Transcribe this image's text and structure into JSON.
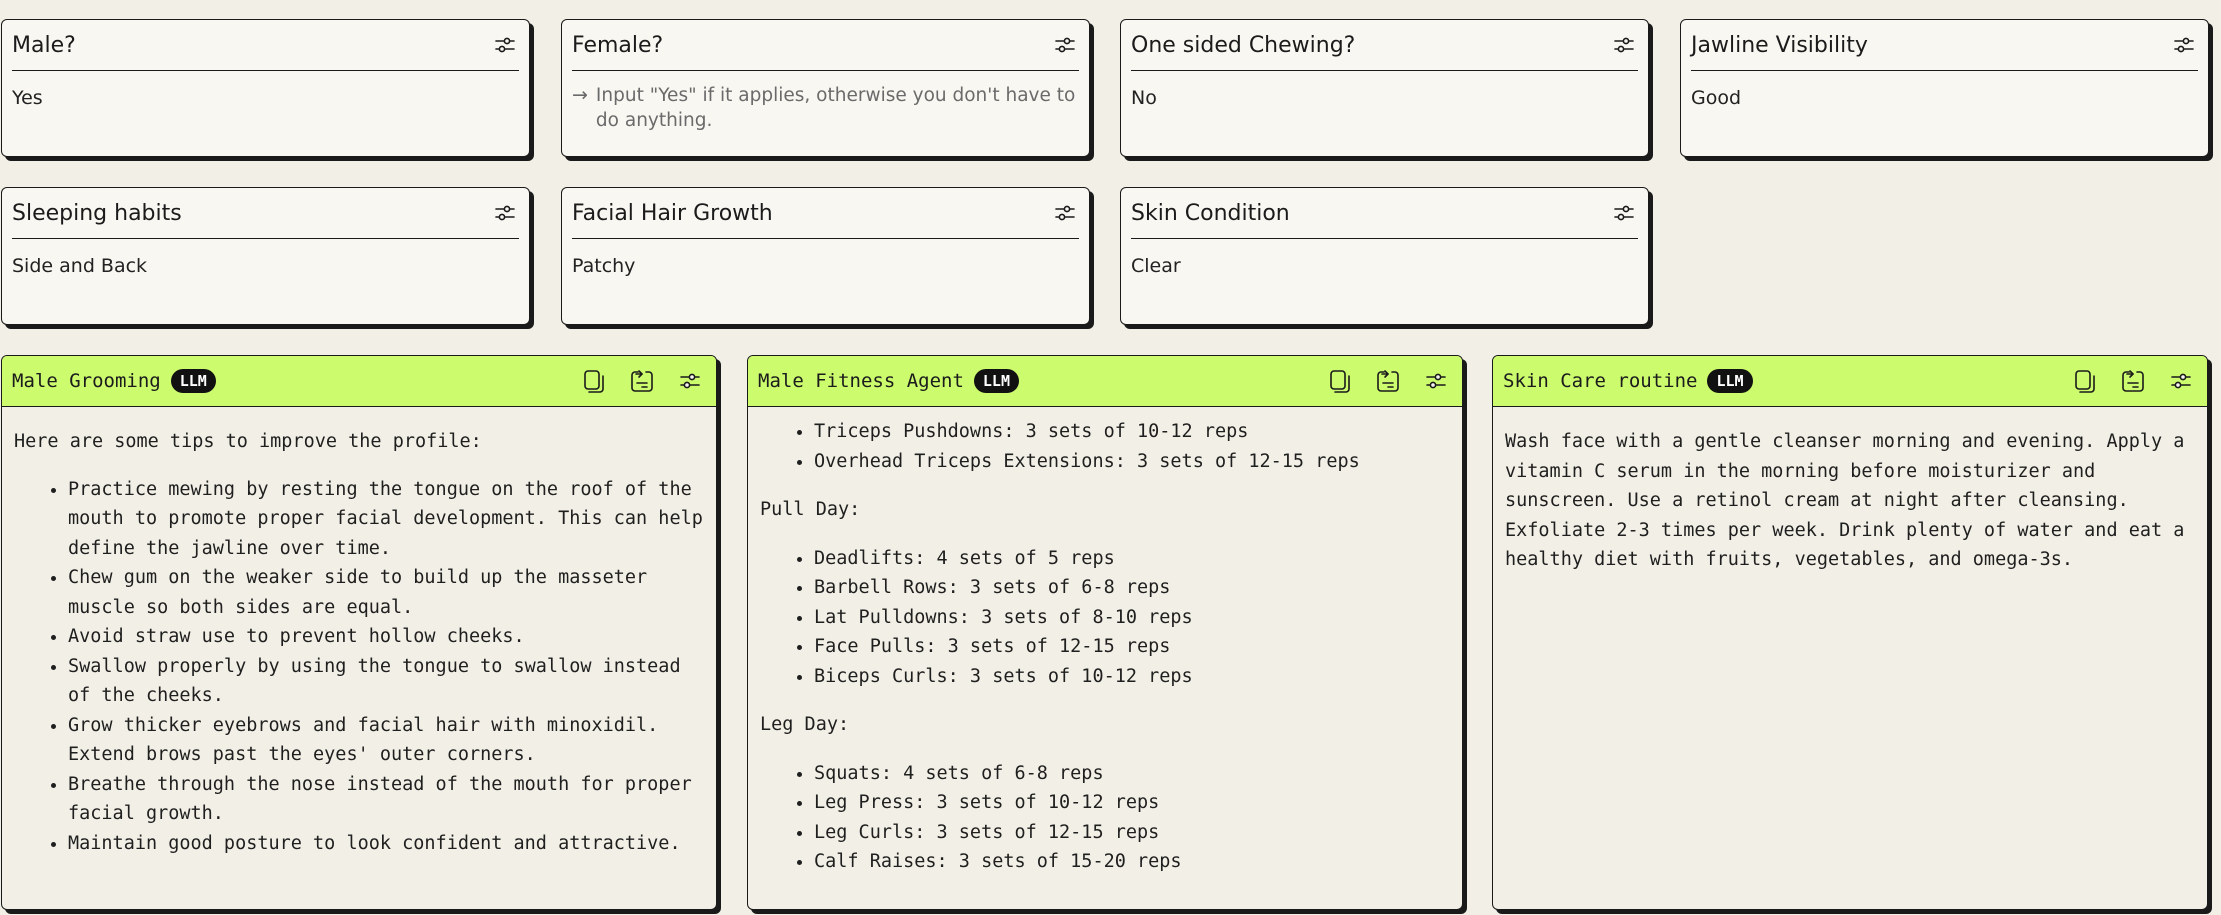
{
  "fields": [
    {
      "title": "Male?",
      "value": "Yes"
    },
    {
      "title": "Female?",
      "placeholder": "Input \"Yes\" if it applies, otherwise you don't have to do anything."
    },
    {
      "title": "One sided Chewing?",
      "value": "No"
    },
    {
      "title": "Jawline Visibility",
      "value": "Good"
    },
    {
      "title": "Sleeping habits",
      "value": "Side and Back"
    },
    {
      "title": "Facial Hair Growth",
      "value": "Patchy"
    },
    {
      "title": "Skin Condition",
      "value": "Clear"
    }
  ],
  "panels": {
    "grooming": {
      "title": "Male Grooming",
      "badge": "LLM",
      "intro": "Here are some tips to improve the profile:",
      "tips": [
        "Practice mewing by resting the tongue on the roof of the mouth to promote proper facial development. This can help define the jawline over time.",
        "Chew gum on the weaker side to build up the masseter muscle so both sides are equal.",
        "Avoid straw use to prevent hollow cheeks.",
        "Swallow properly by using the tongue to swallow instead of the cheeks.",
        "Grow thicker eyebrows and facial hair with minoxidil. Extend brows past the eyes' outer corners.",
        "Breathe through the nose instead of the mouth for proper facial growth.",
        "Maintain good posture to look confident and attractive."
      ]
    },
    "fitness": {
      "title": "Male Fitness Agent",
      "badge": "LLM",
      "push_items": [
        "Triceps Pushdowns: 3 sets of 10-12 reps",
        "Overhead Triceps Extensions: 3 sets of 12-15 reps"
      ],
      "pull_heading": "Pull Day:",
      "pull_items": [
        "Deadlifts: 4 sets of 5 reps",
        "Barbell Rows: 3 sets of 6-8 reps",
        "Lat Pulldowns: 3 sets of 8-10 reps",
        "Face Pulls: 3 sets of 12-15 reps",
        "Biceps Curls: 3 sets of 10-12 reps"
      ],
      "leg_heading": "Leg Day:",
      "leg_items": [
        "Squats: 4 sets of 6-8 reps",
        "Leg Press: 3 sets of 10-12 reps",
        "Leg Curls: 3 sets of 12-15 reps",
        "Calf Raises: 3 sets of 15-20 reps"
      ]
    },
    "skincare": {
      "title": "Skin Care routine",
      "badge": "LLM",
      "text": "Wash face with a gentle cleanser morning and evening. Apply a vitamin C serum in the morning before moisturizer and sunscreen. Use a retinol cream at night after cleansing. Exfoliate 2-3 times per week. Drink plenty of water and eat a healthy diet with fruits, vegetables, and omega-3s."
    }
  },
  "icons": {
    "settings": "sliders-icon",
    "copy": "copy-icon",
    "export": "export-icon"
  },
  "colors": {
    "panel_header": "#ccfb6e",
    "background": "#f2f0e6",
    "card": "#f8f7f2",
    "badge": "#111111"
  }
}
